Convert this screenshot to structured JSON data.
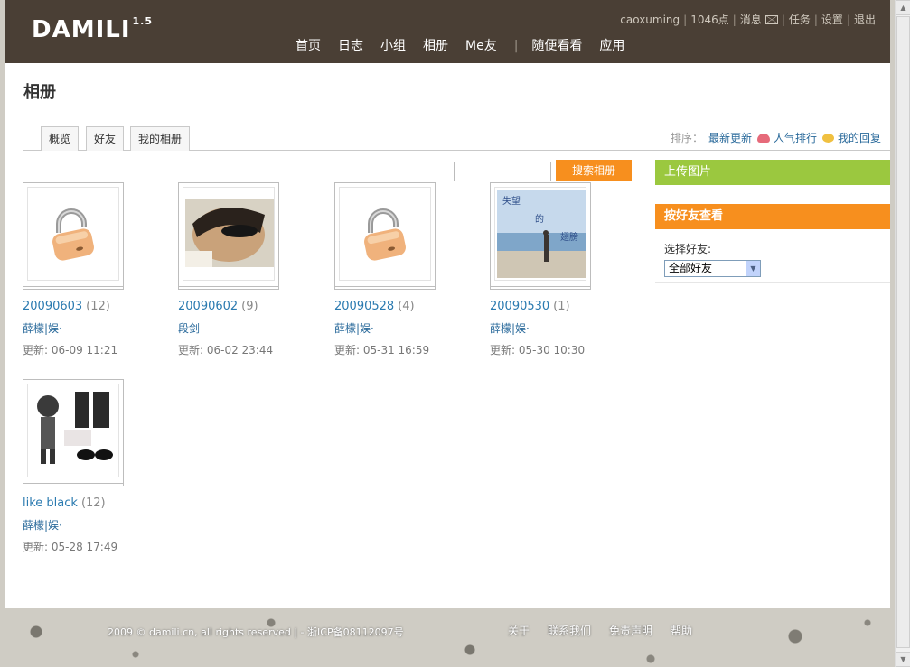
{
  "header": {
    "logo": "DAMILI",
    "logo_version": "1.5",
    "user": {
      "username": "caoxuming",
      "points": "1046点",
      "messages": "消息",
      "tasks": "任务",
      "settings": "设置",
      "logout": "退出"
    },
    "nav": {
      "home": "首页",
      "blog": "日志",
      "groups": "小组",
      "album": "相册",
      "mefriends": "Me友",
      "divider": "|",
      "browse": "随便看看",
      "apps": "应用"
    }
  },
  "page": {
    "title": "相册",
    "tabs": {
      "overview": "概览",
      "friends": "好友",
      "my_albums": "我的相册"
    },
    "sort": {
      "label": "排序：",
      "latest": "最新更新",
      "popular": "人气排行",
      "my_replies": "我的回复"
    },
    "search": {
      "placeholder": "",
      "button": "搜索相册"
    }
  },
  "albums": [
    {
      "name": "20090603",
      "count": "(12)",
      "tags": "薛檬|娱·",
      "updated": "更新: 06-09 11:21",
      "thumb": "lock-icon"
    },
    {
      "name": "20090602",
      "count": "(9)",
      "tags": "段剑",
      "updated": "更新: 06-02 23:44",
      "thumb": "photo-portrait"
    },
    {
      "name": "20090528",
      "count": "(4)",
      "tags": "薛檬|娱·",
      "updated": "更新: 05-31 16:59",
      "thumb": "lock-icon"
    },
    {
      "name": "20090530",
      "count": "(1)",
      "tags": "薛檬|娱·",
      "updated": "更新: 05-30 10:30",
      "thumb": "photo-beach",
      "thumb_text": [
        "失望",
        "的",
        "翅膀"
      ]
    },
    {
      "name": "like black",
      "count": "(12)",
      "tags": "薛檬|娱·",
      "updated": "更新: 05-28 17:49",
      "thumb": "photo-fashion"
    }
  ],
  "sidebar": {
    "upload": "上传图片",
    "by_friends": "按好友查看",
    "select_label": "选择好友:",
    "select_value": "全部好友"
  },
  "footer": {
    "copyright": "2009 © damili.cn, all rights reserved | - 浙ICP备08112097号",
    "links": {
      "about": "关于",
      "contact": "联系我们",
      "disclaimer": "免责声明",
      "help": "帮助"
    }
  },
  "colors": {
    "header_bg": "#4a3f35",
    "link_blue": "#2a7ab0",
    "orange": "#f78f1e",
    "green": "#9bc83f"
  }
}
